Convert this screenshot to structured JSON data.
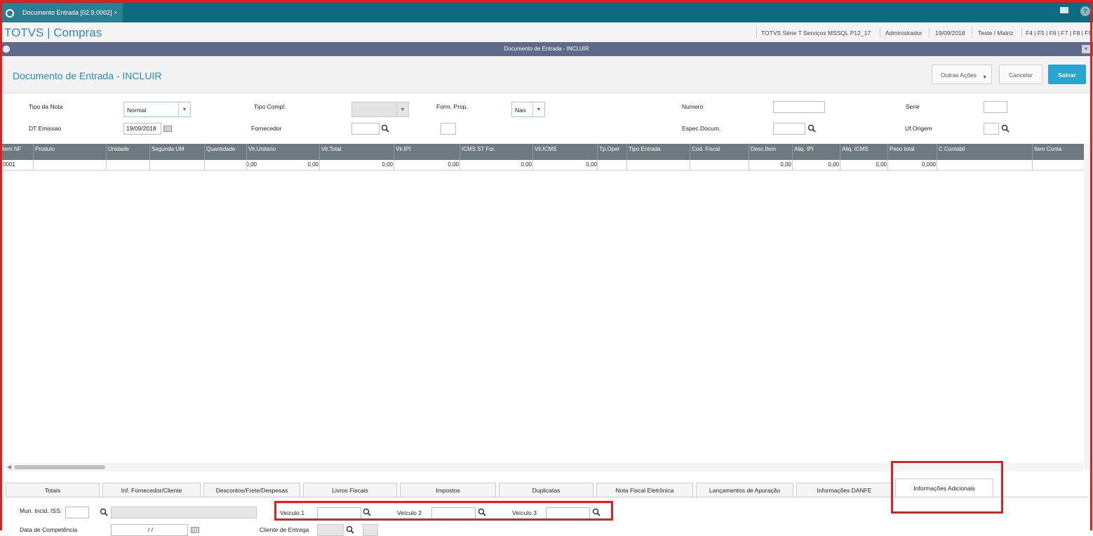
{
  "tabbar": {
    "tab_label": "Documento Entrada [02.9.0002]",
    "close": "×",
    "help": "?"
  },
  "header": {
    "app_title": "TOTVS | Compras",
    "environment": "TOTVS Série T Serviços MSSQL P12_17",
    "user": "Administrador",
    "date": "19/09/2018",
    "branch": "Teste / Matriz",
    "shortcuts": "F4 | F5 | F6 | F7 | F8 | F9"
  },
  "window": {
    "title": "Documento de Entrada - INCLUIR",
    "close": "×"
  },
  "page": {
    "title": "Documento de Entrada - INCLUIR",
    "actions": {
      "outras": "Outras Ações",
      "cancelar": "Cancelar",
      "salvar": "Salvar"
    }
  },
  "form": {
    "tipo_nota": {
      "label": "Tipo da Nota",
      "value": "Normal"
    },
    "tipo_compl": {
      "label": "Tipo Compl.",
      "value": ""
    },
    "form_prop": {
      "label": "Form. Prop.",
      "value": "Nao"
    },
    "numero": {
      "label": "Numero",
      "value": ""
    },
    "serie": {
      "label": "Serie",
      "value": ""
    },
    "dt_emissao": {
      "label": "DT Emissao",
      "value": "19/09/2018"
    },
    "fornecedor": {
      "label": "Fornecedor",
      "value": ""
    },
    "espec_docum": {
      "label": "Espec.Docum.",
      "value": ""
    },
    "uf_origem": {
      "label": "Uf.Origem",
      "value": ""
    }
  },
  "grid": {
    "columns": [
      "Item NF",
      "Produto",
      "Unidade",
      "Segunda UM",
      "Quantidade",
      "Vlr.Unitario",
      "Vlr.Total",
      "Vlr.IPI",
      "ICMS ST For.",
      "Vlr.ICMS",
      "Tp.Oper",
      "Tipo Entrada",
      "Cod. Fiscal",
      "Desc.Item",
      "Aliq. IPI",
      "Aliq. ICMS",
      "Peso total",
      "C Contabil",
      "Item Conta"
    ],
    "row": [
      "0001",
      "",
      "",
      "",
      "0,00",
      "0,00",
      "0,00",
      "0,00",
      "0,00",
      "0,00",
      "",
      "",
      "",
      "0,00",
      "0,00",
      "0,00",
      "0,000",
      "",
      ""
    ]
  },
  "tabs": [
    "Totais",
    "Inf. Fornecedor/Cliente",
    "Descontos/Frete/Despesas",
    "Livros Fiscais",
    "Impostos",
    "Duplicatas",
    "Nota Fiscal Eletrônica",
    "Lançamentos de Apuração",
    "Informações DANFE",
    "Informações Adicionais"
  ],
  "active_tab": "Informações Adicionais",
  "info_adicionais": {
    "mun_incid_iss": {
      "label": "Mun. Incid. ISS:",
      "value": ""
    },
    "veiculo1": {
      "label": "Veículo 1",
      "value": ""
    },
    "veiculo2": {
      "label": "Veículo 2",
      "value": ""
    },
    "veiculo3": {
      "label": "Veículo 3",
      "value": ""
    },
    "data_competencia": {
      "label": "Data de Competência",
      "value": "  /  /  "
    },
    "cliente_entrega": {
      "label": "Cliente de Entrega",
      "value": ""
    }
  },
  "colors": {
    "accent": "#2ba4cf",
    "topbar": "#0f6b7f",
    "highlight": "#e02020"
  }
}
